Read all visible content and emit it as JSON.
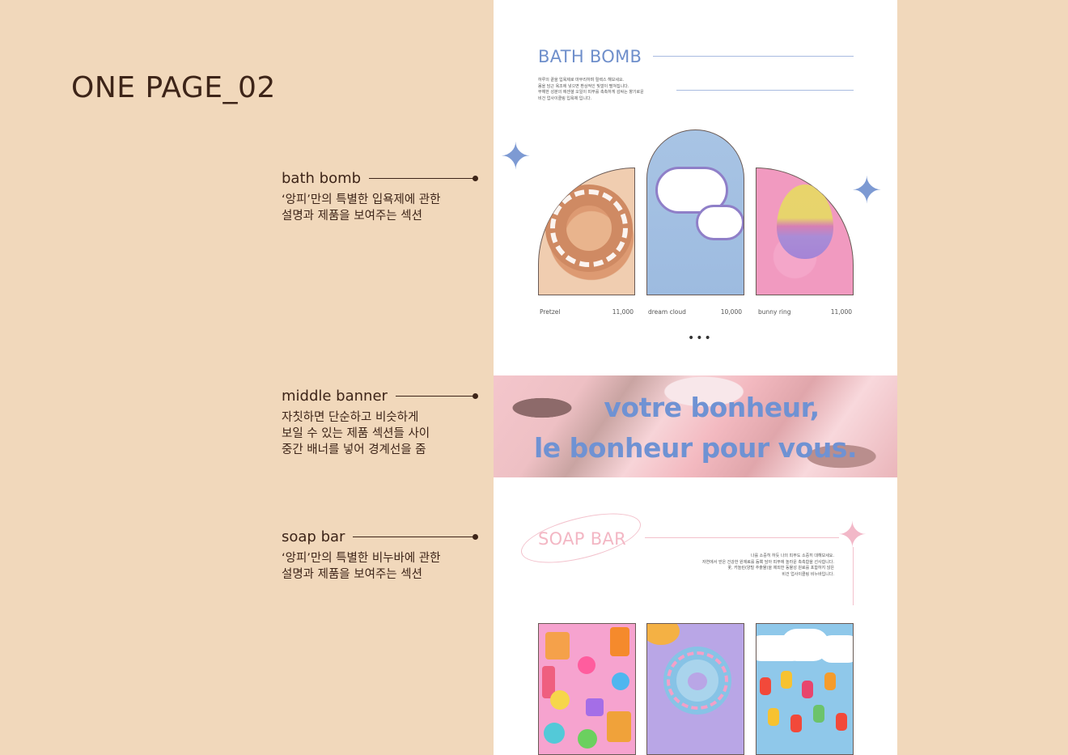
{
  "page_title": "ONE PAGE_02",
  "notes": [
    {
      "label": "bath bomb",
      "desc": "‘앙피’만의 특별한 입욕제에 관한\n설명과 제품을 보여주는 섹션"
    },
    {
      "label": "middle banner",
      "desc": "자칫하면 단순하고 비슷하게\n보일 수 있는 제품 섹션들 사이\n중간 배너를 넣어 경계선을 줌"
    },
    {
      "label": "soap bar",
      "desc": "‘앙피’만의 특별한 비누바에 관한\n설명과 제품을 보여주는 섹션"
    }
  ],
  "bath_bomb": {
    "title": "BATH BOMB",
    "desc": "하루의 끝을 입욕제로 마무리하며 릴렉스 해보세요.\n몸을 담근 욕조에 넣으면 환상적인 빛깔이 펼쳐집니다.\n부해한 성분의 에센셜 오일이 피부를 촉촉하게 감싸는 향기로운\n비건 업사이클링 입욕제 입니다.",
    "products": [
      {
        "name": "Pretzel",
        "price": "11,000"
      },
      {
        "name": "dream cloud",
        "price": "10,000"
      },
      {
        "name": "bunny ring",
        "price": "11,000"
      }
    ],
    "more": "•••"
  },
  "banner": {
    "line1": "votre bonheur,",
    "line2": "le bonheur pour vous."
  },
  "soap_bar": {
    "title": "SOAP BAR",
    "desc": "나를 소중히 하듯 나의 피부도 소중히 대해보세요.\n자연에서 얻은 건강한 원재료를 듬뿍 담아 피부에 놀라운 촉촉함을 선사합니다.\n꽃, 카놀린(양털 추출물)을 제외한 동물성 원료를 포함하지 않은\n비건 업사이클링 비누바입니다."
  },
  "colors": {
    "background": "#f1d8bb",
    "bath_bomb_accent": "#6f8fcb",
    "soap_bar_accent": "#f3b7c4",
    "text": "#3d2418"
  },
  "icons": [
    "sparkle-icon"
  ]
}
